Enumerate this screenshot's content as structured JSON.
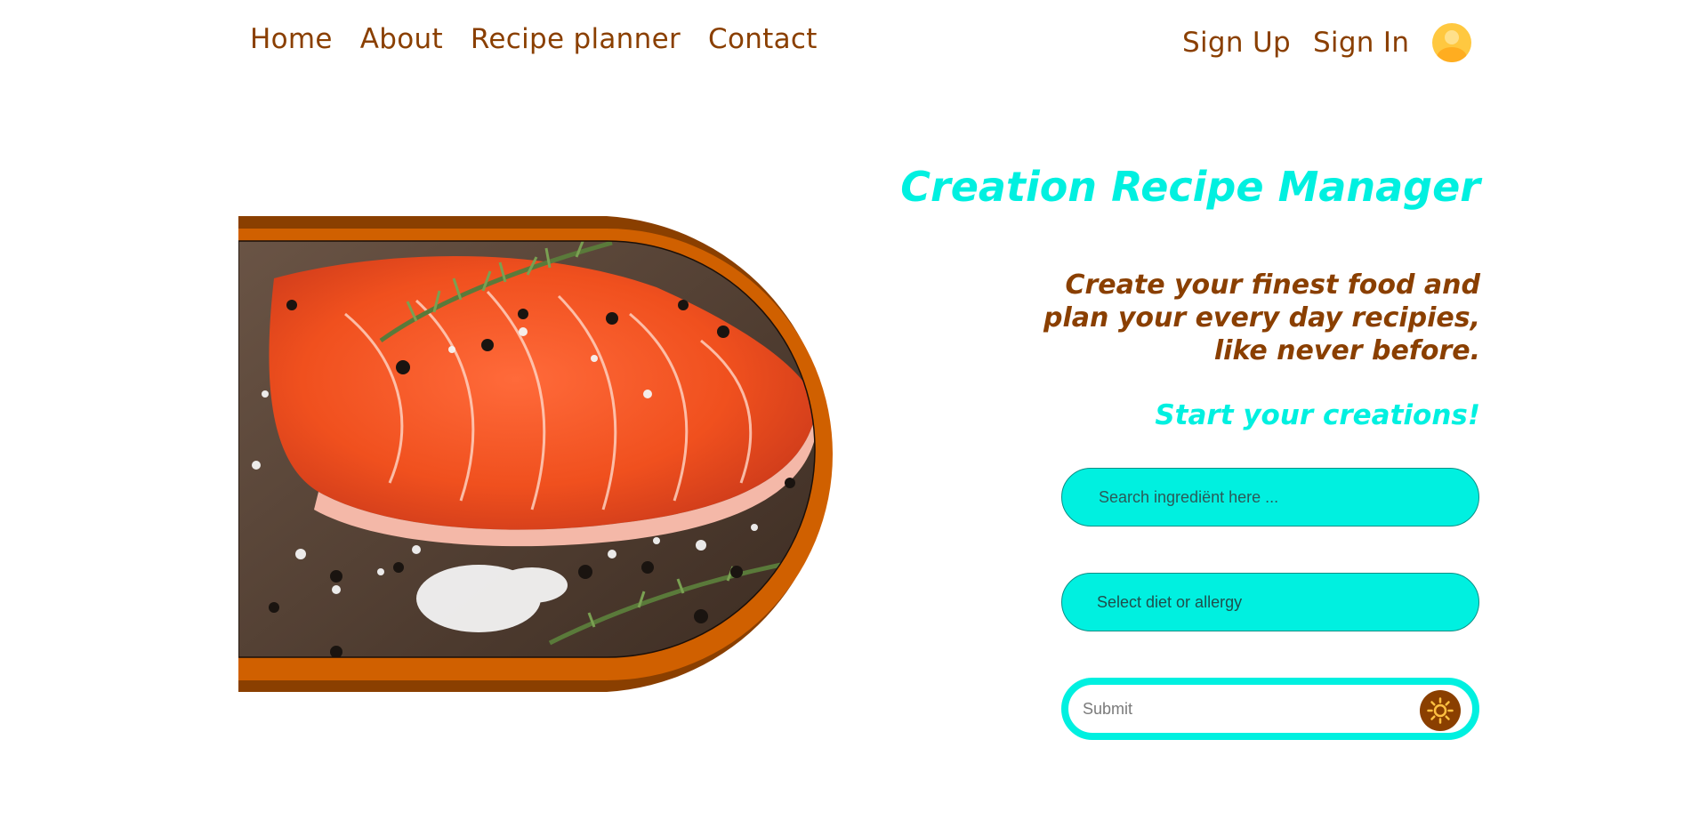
{
  "nav": {
    "left": [
      {
        "label": "Home"
      },
      {
        "label": "About"
      },
      {
        "label": "Recipe planner"
      },
      {
        "label": "Contact"
      }
    ],
    "sign_up": "Sign Up",
    "sign_in": "Sign In",
    "avatar_icon": "user-avatar-icon"
  },
  "hero": {
    "title": "Creation Recipe Manager",
    "tagline": "Create your finest food and plan your every day recipies, like never before.",
    "cta": "Start your creations!",
    "image_subject": "salmon fillet with rosemary, peppercorns and sea salt"
  },
  "form": {
    "search_placeholder": "Search ingrediënt here ...",
    "diet_select": "Select diet or allergy",
    "submit_placeholder": "Submit",
    "submit_icon": "sun-icon"
  },
  "colors": {
    "brown": "#8a3f00",
    "orange": "#d06000",
    "cyan": "#00f0e0"
  }
}
